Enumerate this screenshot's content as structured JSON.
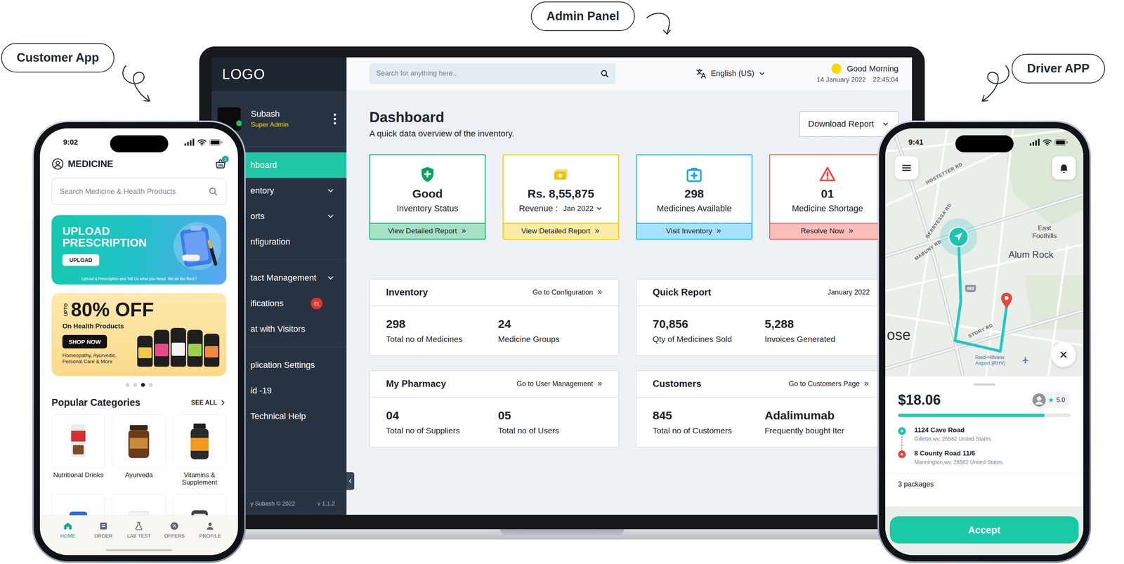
{
  "labels": [
    {
      "text": "Customer App"
    },
    {
      "text": "Admin Panel"
    },
    {
      "text": "Driver APP"
    }
  ],
  "admin": {
    "sidebar": {
      "logo": "LOGO",
      "user": {
        "name": "Subash",
        "role": "Super Admin",
        "online": true
      },
      "sections": [
        [
          {
            "label": "hboard",
            "selected": true,
            "expandable": false
          },
          {
            "label": "entory",
            "selected": false,
            "expandable": true
          },
          {
            "label": "orts",
            "selected": false,
            "expandable": true
          },
          {
            "label": "nfiguration",
            "selected": false,
            "expandable": false
          }
        ],
        [
          {
            "label": "tact Management",
            "selected": false,
            "expandable": true
          },
          {
            "label": "ifications",
            "selected": false,
            "expandable": false,
            "badge": "01"
          },
          {
            "label": "at with Visitors",
            "selected": false,
            "expandable": false
          }
        ],
        [
          {
            "label": "plication Settings",
            "selected": false,
            "expandable": false
          },
          {
            "label": "id -19",
            "selected": false,
            "expandable": false
          },
          {
            "label": "Technical Help",
            "selected": false,
            "expandable": false
          }
        ]
      ],
      "footer": {
        "credit": "y Subash © 2022",
        "version": "v 1.1.2"
      }
    },
    "header": {
      "search": {
        "placeholder": "Search for anything here.."
      },
      "language": "English (US)",
      "greeting": "Good Morning",
      "date": "14 January 2022",
      "time": "22:45:04"
    },
    "dashboard": {
      "title": "Dashboard",
      "subtitle": "A quick data overview of the inventory.",
      "download": "Download Report",
      "cards": [
        {
          "value": "Good",
          "label": "Inventory Status",
          "action": "View Detailed Report",
          "color": "#03a65a"
        },
        {
          "value": "Rs. 8,55,875",
          "label": "Revenue :",
          "period": "Jan 2022",
          "action": "View Detailed Report",
          "color": "#f2c500"
        },
        {
          "value": "298",
          "label": "Medicines Available",
          "action": "Visit Inventory",
          "color": "#03a9f5"
        },
        {
          "value": "01",
          "label": "Medicine Shortage",
          "action": "Resolve Now",
          "color": "#f0483e"
        }
      ],
      "panels": [
        {
          "title": "Inventory",
          "link": "Go to Configuration",
          "stats": [
            {
              "value": "298",
              "label": "Total no of Medicines"
            },
            {
              "value": "24",
              "label": "Medicine Groups"
            }
          ]
        },
        {
          "title": "Quick Report",
          "period": "January 2022",
          "stats": [
            {
              "value": "70,856",
              "label": "Qty of Medicines Sold"
            },
            {
              "value": "5,288",
              "label": "Invoices Generated"
            }
          ]
        },
        {
          "title": "My Pharmacy",
          "link": "Go to User Management",
          "stats": [
            {
              "value": "04",
              "label": "Total no of Suppliers"
            },
            {
              "value": "05",
              "label": "Total no of Users"
            }
          ]
        },
        {
          "title": "Customers",
          "link": "Go to Customers Page",
          "stats": [
            {
              "value": "845",
              "label": "Total no of Customers"
            },
            {
              "value": "Adalimumab",
              "label": "Frequently bought Iter"
            }
          ]
        }
      ]
    }
  },
  "customer": {
    "status": {
      "time": "9:02"
    },
    "header": {
      "title": "MEDICINE",
      "cart_count": "2"
    },
    "search": {
      "placeholder": "Search Medicine & Health Products"
    },
    "banners": {
      "prescription": {
        "title": "UPLOAD PRESCRIPTION",
        "button": "UPLOAD",
        "note": "Upload a Prescription and Tell Us what you Need. We do the Rest.!"
      },
      "offer": {
        "prefix": "UPTO",
        "headline": "80% OFF",
        "subtitle": "On Health Products",
        "button": "SHOP NOW",
        "note": "Homeopathy, Ayurvedic, Personal Care & More"
      }
    },
    "carousel": [
      {
        "selected": false
      },
      {
        "selected": false
      },
      {
        "selected": true
      },
      {
        "selected": false
      }
    ],
    "categories": {
      "title": "Popular Categories",
      "see_all": "SEE ALL",
      "items": [
        {
          "label": "Nutritional Drinks"
        },
        {
          "label": "Ayurveda"
        },
        {
          "label": "Vitamins & Supplement"
        }
      ]
    },
    "nav": [
      {
        "label": "HOME",
        "selected": true
      },
      {
        "label": "ORDER",
        "selected": false
      },
      {
        "label": "LAB TEST",
        "selected": false
      },
      {
        "label": "OFFERS",
        "selected": false
      },
      {
        "label": "PROFILE",
        "selected": false
      }
    ]
  },
  "driver": {
    "status": {
      "time": "9:41"
    },
    "map": {
      "labels": [
        {
          "text": "HOSTETTER RD"
        },
        {
          "text": "BERRYESSA RD"
        },
        {
          "text": "MABURY RD"
        },
        {
          "text": "East Foothills"
        },
        {
          "text": "Alum Rock"
        },
        {
          "text": "ose"
        },
        {
          "text": "STORY RD"
        },
        {
          "text": "680"
        },
        {
          "text": "Reid-Hillview Airport (RHV)"
        }
      ]
    },
    "fare": "$18.06",
    "rating": {
      "star": "★",
      "value": "5.0"
    },
    "progress": {
      "level": 0.85
    },
    "stops": [
      {
        "address": "1124 Cave Road",
        "detail": "Gillette,wv, 26582 United States",
        "color": "#1ec5a8"
      },
      {
        "address": "8 County Road 11/6",
        "detail": "Mannington,wv, 26582 United States",
        "color": "#e8453c"
      }
    ],
    "packages": "3 packages",
    "button": "Accept"
  }
}
